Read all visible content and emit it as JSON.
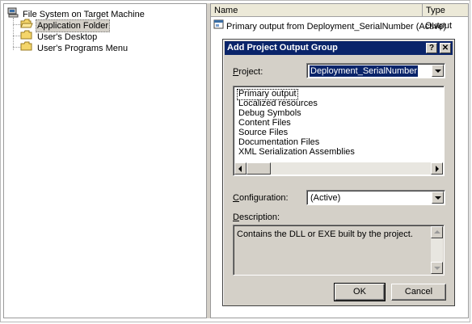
{
  "tree": {
    "root_label": "File System on Target Machine",
    "children": [
      {
        "label": "Application Folder",
        "selected": true
      },
      {
        "label": "User's Desktop",
        "selected": false
      },
      {
        "label": "User's Programs Menu",
        "selected": false
      }
    ]
  },
  "list": {
    "columns": [
      {
        "label": "Name"
      },
      {
        "label": "Type"
      }
    ],
    "rows": [
      {
        "name": "Primary output from Deployment_SerialNumber (Active)",
        "type": "Output"
      }
    ]
  },
  "dialog": {
    "title": "Add Project Output Group",
    "help_button": "?",
    "close_button": "✕",
    "project_label_prefix": "P",
    "project_label_rest": "roject:",
    "project_value": "Deployment_SerialNumber",
    "outputs": [
      "Primary output",
      "Localized resources",
      "Debug Symbols",
      "Content Files",
      "Source Files",
      "Documentation Files",
      "XML Serialization Assemblies"
    ],
    "selected_output_index": 0,
    "configuration_label_prefix": "C",
    "configuration_label_rest": "onfiguration:",
    "configuration_value": "(Active)",
    "description_label_prefix": "D",
    "description_label_rest": "escription:",
    "description_text": "Contains the DLL or EXE built by the project.",
    "ok_label": "OK",
    "cancel_label": "Cancel"
  },
  "colors": {
    "titlebar": "#0a246a",
    "dialog_face": "#d4d0c8",
    "selection": "#0a246a"
  },
  "icons": {
    "computer": "computer-icon",
    "folder": "folder-icon",
    "output": "project-output-icon"
  }
}
